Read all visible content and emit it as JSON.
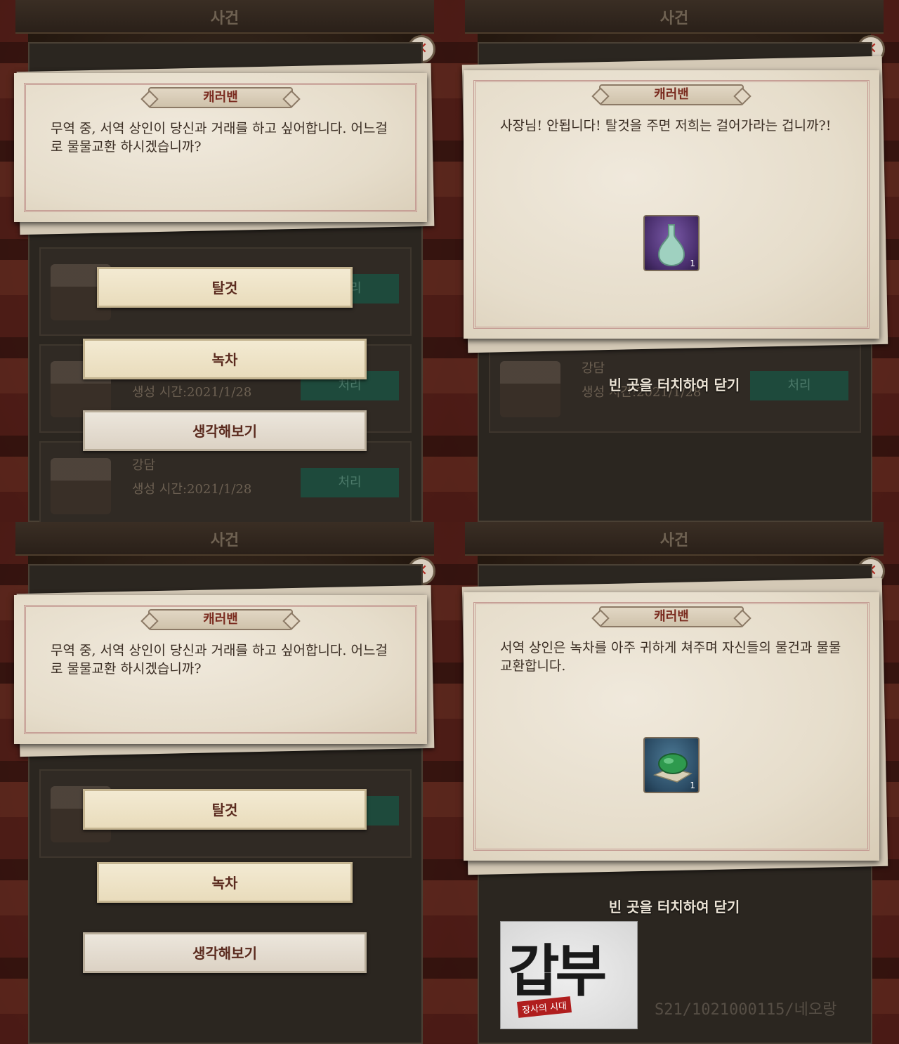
{
  "screen": {
    "title": "사건",
    "close_icon": "close-x-icon"
  },
  "list_rows": {
    "row_a": {
      "title": "강담",
      "subtitle": "생성 시간:2021/1/28",
      "action": "처리"
    },
    "row_b": {
      "title": "강담",
      "subtitle": "생성 시간:2021/1/28",
      "action": "처리"
    }
  },
  "event": {
    "tag": "캐러밴",
    "question": "무역 중, 서역 상인이 당신과 거래를 하고 싶어합니다. 어느걸로 물물교환 하시겠습니까?",
    "choices": [
      "탈것",
      "녹차",
      "생각해보기"
    ],
    "result_mount": "사장님! 안됩니다! 탈것을 주면 저희는 걸어가라는 겁니까?!",
    "result_tea": "서역 상인은 녹차를 아주 귀하게 쳐주며 자신들의 물건과 물물교환합니다.",
    "reward_vase": {
      "icon": "vase-icon",
      "qty": "1"
    },
    "reward_jade": {
      "icon": "jade-icon",
      "qty": "1"
    },
    "tap_to_close": "빈 곳을 터치하여 닫기"
  },
  "watermark": {
    "logo_text": "갑부",
    "logo_sub": "장사의 시대",
    "code": "S21/1021000115/네오랑"
  },
  "colors": {
    "process_button": "#1e4a3c",
    "tag_text": "#7a2b1f",
    "purple_slot": "#4a2f6e",
    "blue_slot": "#2c4d66"
  }
}
